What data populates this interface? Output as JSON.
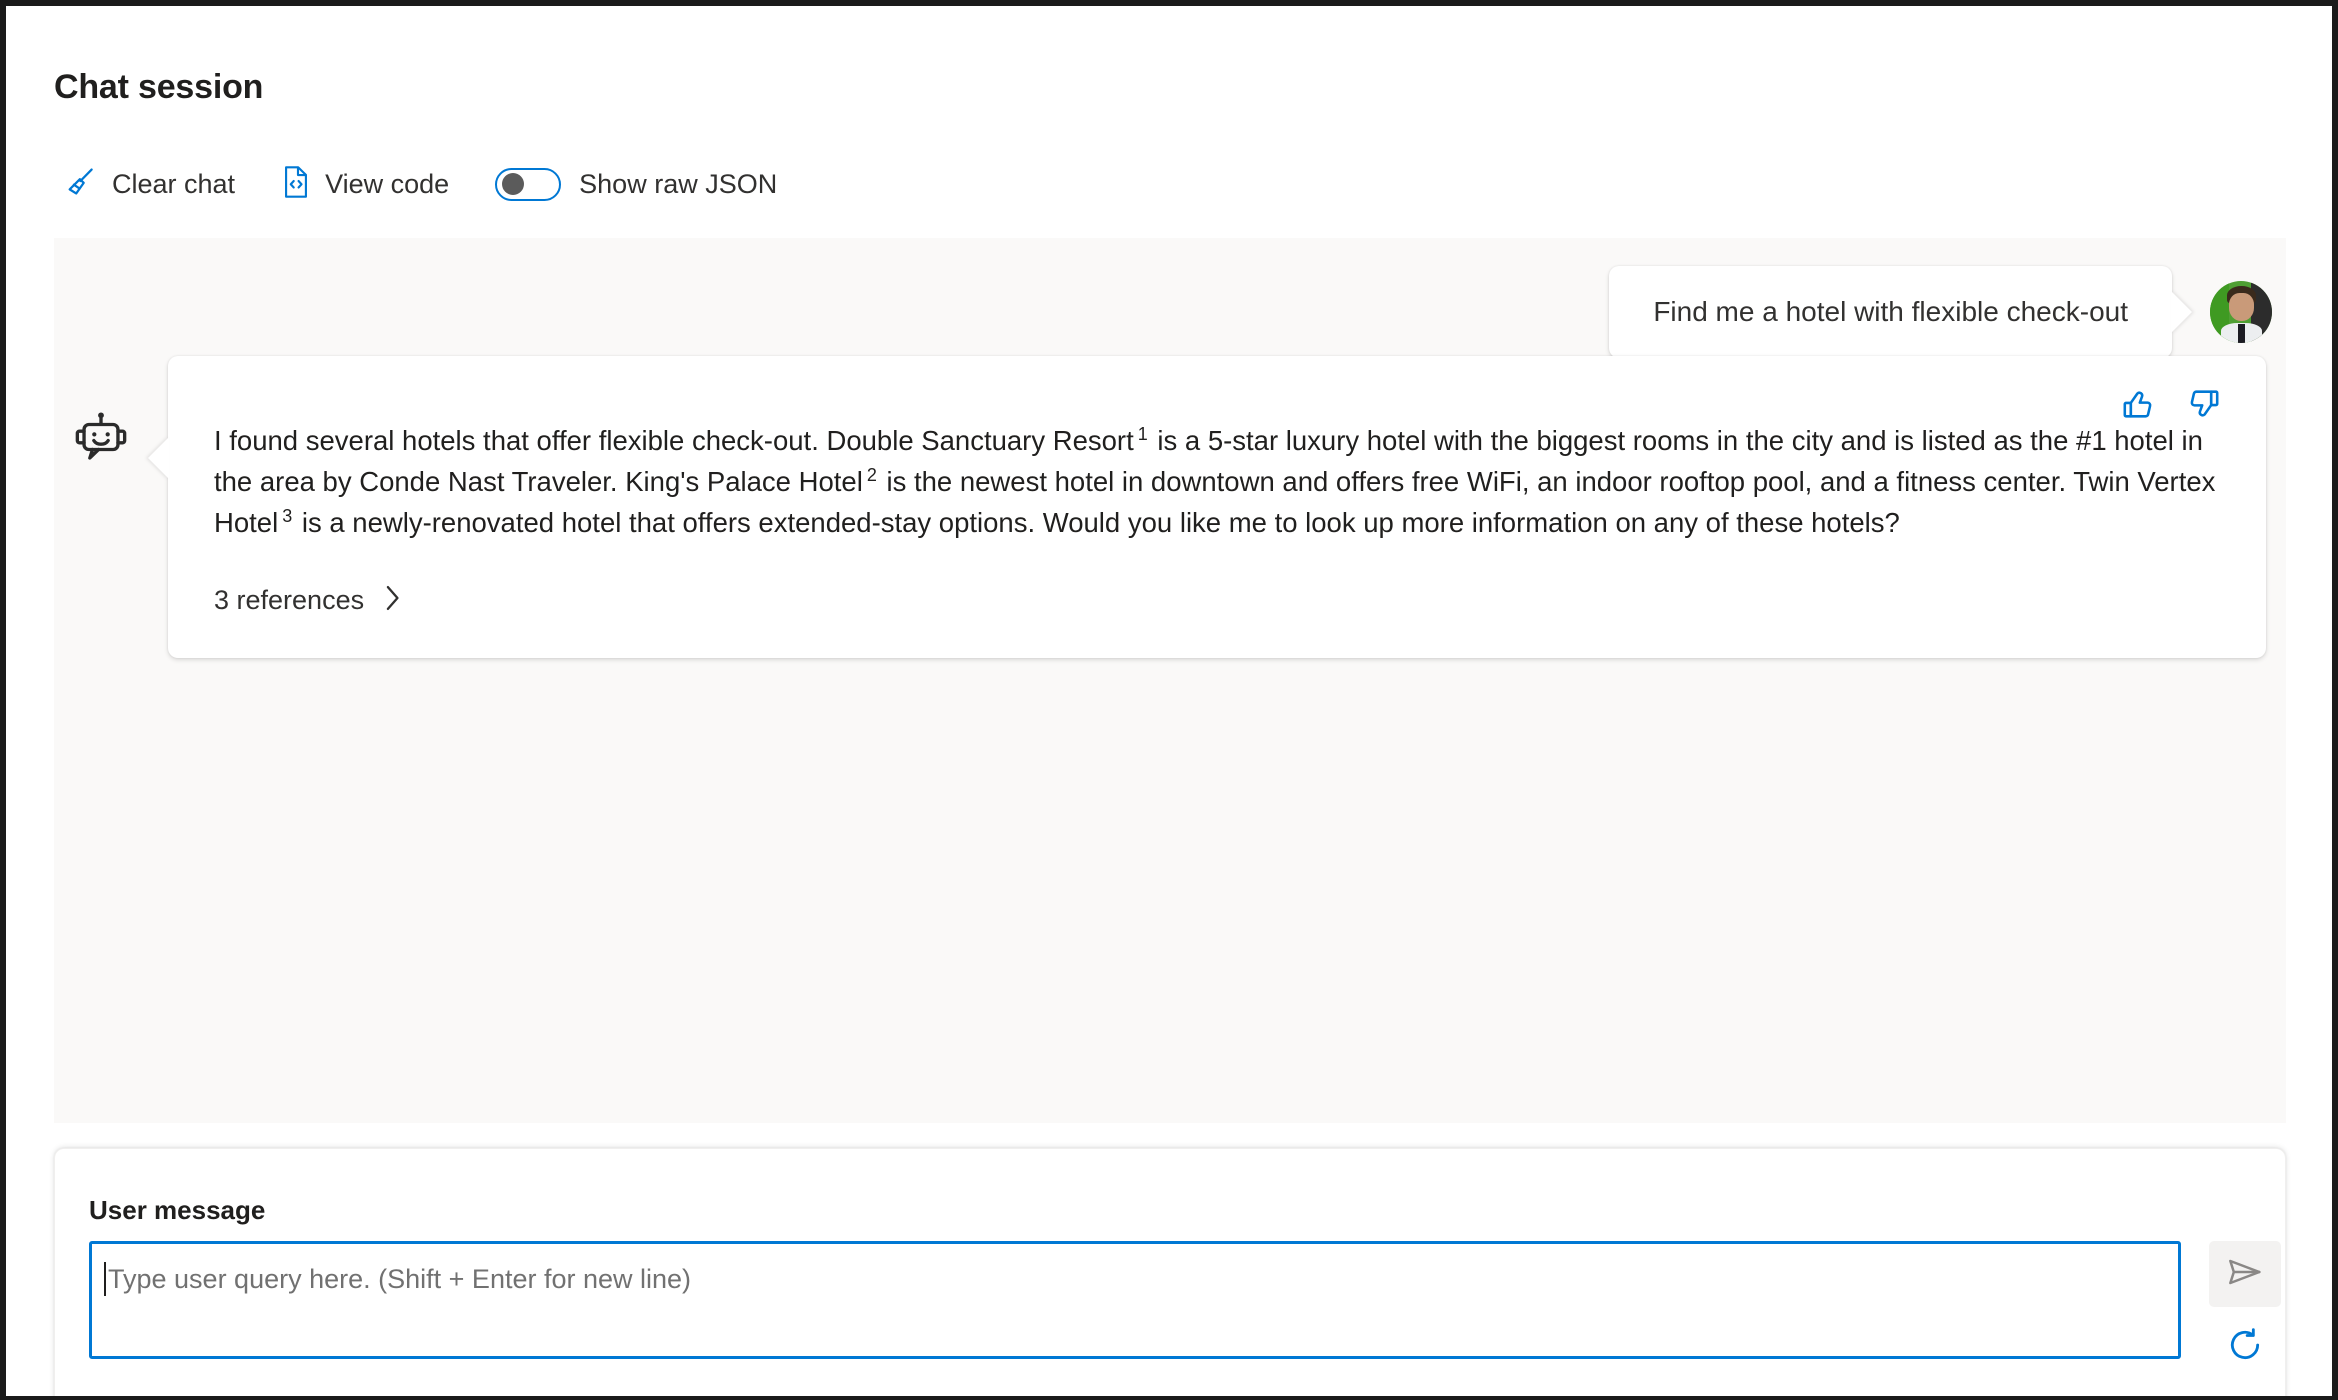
{
  "header": {
    "title": "Chat session"
  },
  "toolbar": {
    "clear_chat_label": "Clear chat",
    "clear_chat_icon": "broom-icon",
    "view_code_label": "View code",
    "view_code_icon": "code-file-icon",
    "show_raw_json_label": "Show raw JSON",
    "show_raw_json_state": "off",
    "accent_color": "#0078d4",
    "toggle_knob_color": "#5b5b5b"
  },
  "chat": {
    "background_color": "#faf9f8",
    "user_message": {
      "text": "Find me a hotel with flexible check-out",
      "avatar": "user-photo-avatar"
    },
    "bot_message": {
      "avatar_icon": "robot-icon",
      "segments": [
        {
          "type": "text",
          "value": "I found several hotels that offer flexible check-out. Double Sanctuary Resort"
        },
        {
          "type": "citation",
          "value": "1"
        },
        {
          "type": "text",
          "value": " is a 5-star luxury hotel with the biggest rooms in the city and is listed as the #1 hotel in the area by Conde Nast Traveler. King's Palace Hotel"
        },
        {
          "type": "citation",
          "value": "2"
        },
        {
          "type": "text",
          "value": " is the newest hotel in downtown and offers free WiFi, an indoor rooftop pool, and a fitness center. Twin Vertex Hotel"
        },
        {
          "type": "citation",
          "value": "3"
        },
        {
          "type": "text",
          "value": " is a newly-renovated hotel that offers extended-stay options. Would you like me to look up more information on any of these hotels?"
        }
      ],
      "references_label": "3 references",
      "references_chevron_icon": "chevron-right-icon",
      "thumbs_up_icon": "thumbs-up-icon",
      "thumbs_down_icon": "thumbs-down-icon",
      "feedback_color": "#0078d4"
    }
  },
  "composer": {
    "label": "User message",
    "placeholder": "Type user query here. (Shift + Enter for new line)",
    "value": "",
    "send_icon": "send-paper-plane-icon",
    "regenerate_icon": "refresh-circle-icon",
    "focus_border_color": "#0078d4"
  },
  "pointer": {
    "icon": "mouse-cursor-arrow"
  }
}
